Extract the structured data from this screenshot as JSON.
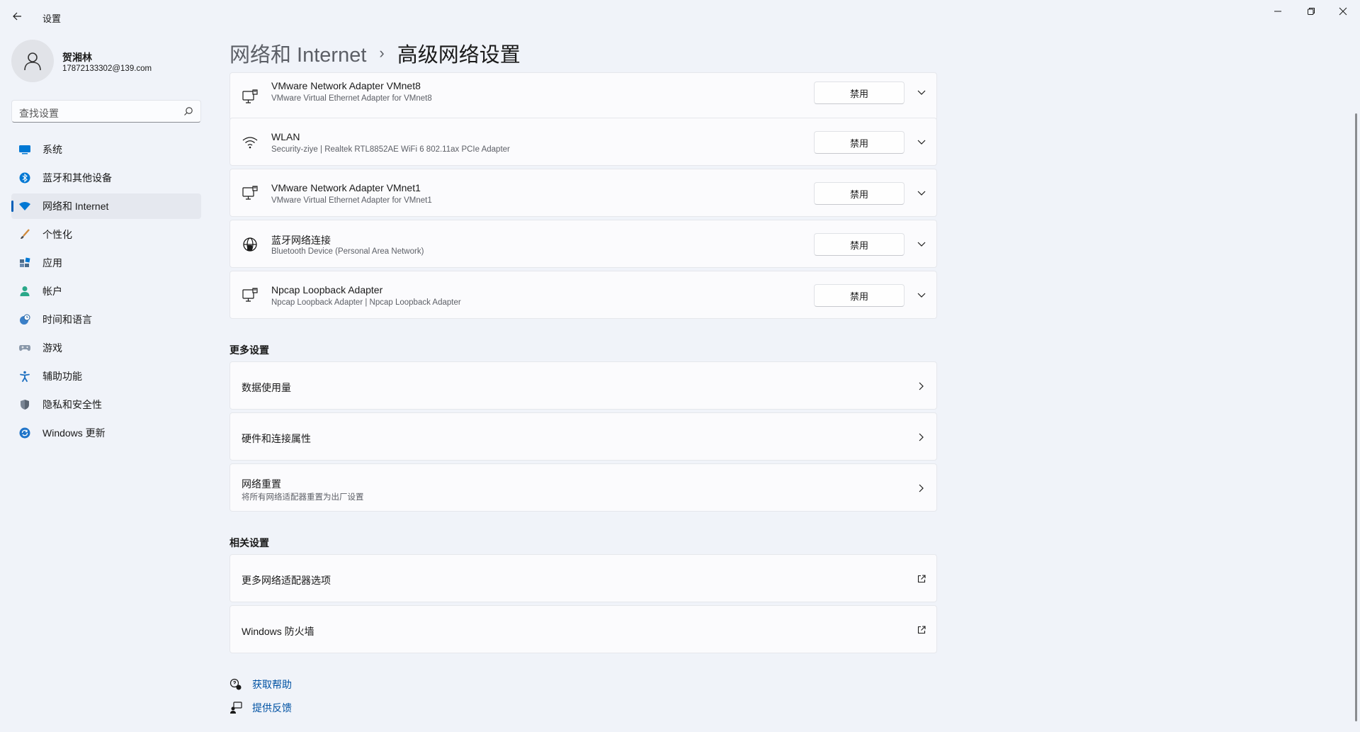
{
  "app": {
    "title": "设置"
  },
  "profile": {
    "name": "贺湘林",
    "email": "17872133302@139.com"
  },
  "search": {
    "placeholder": "查找设置"
  },
  "sidebar": {
    "items": [
      {
        "label": "系统",
        "icon": "system-icon"
      },
      {
        "label": "蓝牙和其他设备",
        "icon": "bluetooth-icon"
      },
      {
        "label": "网络和 Internet",
        "icon": "wifi-icon",
        "active": true
      },
      {
        "label": "个性化",
        "icon": "brush-icon"
      },
      {
        "label": "应用",
        "icon": "apps-icon"
      },
      {
        "label": "帐户",
        "icon": "account-icon"
      },
      {
        "label": "时间和语言",
        "icon": "globe-clock-icon"
      },
      {
        "label": "游戏",
        "icon": "gamepad-icon"
      },
      {
        "label": "辅助功能",
        "icon": "accessibility-icon"
      },
      {
        "label": "隐私和安全性",
        "icon": "shield-icon"
      },
      {
        "label": "Windows 更新",
        "icon": "update-icon"
      }
    ]
  },
  "breadcrumb": {
    "parent": "网络和 Internet",
    "separator": "›",
    "current": "高级网络设置"
  },
  "adapters": [
    {
      "name": "VMware Network Adapter VMnet8",
      "desc": "VMware Virtual Ethernet Adapter for VMnet8",
      "button": "禁用",
      "icon": "ethernet-icon"
    },
    {
      "name": "WLAN",
      "desc": "Security-ziye | Realtek RTL8852AE WiFi 6 802.11ax PCIe Adapter",
      "button": "禁用",
      "icon": "wifi-icon"
    },
    {
      "name": "VMware Network Adapter VMnet1",
      "desc": "VMware Virtual Ethernet Adapter for VMnet1",
      "button": "禁用",
      "icon": "ethernet-icon"
    },
    {
      "name": "蓝牙网络连接",
      "desc": "Bluetooth Device (Personal Area Network)",
      "button": "禁用",
      "icon": "globe-icon"
    },
    {
      "name": "Npcap Loopback Adapter",
      "desc": "Npcap Loopback Adapter | Npcap Loopback Adapter",
      "button": "禁用",
      "icon": "ethernet-icon"
    }
  ],
  "more_settings": {
    "title": "更多设置",
    "items": [
      {
        "label": "数据使用量"
      },
      {
        "label": "硬件和连接属性"
      },
      {
        "label": "网络重置",
        "sub": "将所有网络适配器重置为出厂设置"
      }
    ]
  },
  "related_settings": {
    "title": "相关设置",
    "items": [
      {
        "label": "更多网络适配器选项"
      },
      {
        "label": "Windows 防火墙"
      }
    ]
  },
  "help": {
    "get_help": "获取帮助",
    "feedback": "提供反馈"
  },
  "colors": {
    "accent": "#005fb8",
    "link": "#0052a3",
    "background": "#f0f3f9"
  }
}
